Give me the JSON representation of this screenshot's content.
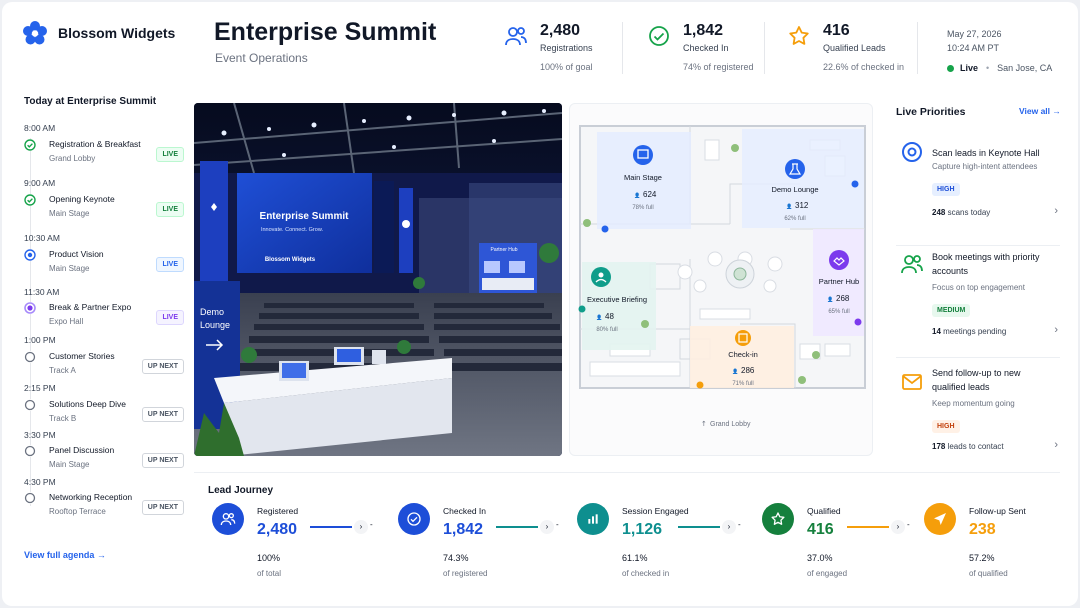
{
  "brand": {
    "name": "Blossom Widgets"
  },
  "header": {
    "title": "Enterprise Summit",
    "subtitle": "Event Operations"
  },
  "kpis": [
    {
      "value": "2,480",
      "label": "Registrations",
      "sub": "100% of goal",
      "icon": "users-icon",
      "color": "#2563eb"
    },
    {
      "value": "1,842",
      "label": "Checked In",
      "sub": "74% of registered",
      "icon": "check-circle-icon",
      "color": "#16a34a"
    },
    {
      "value": "416",
      "label": "Qualified Leads",
      "sub": "22.6% of checked in",
      "icon": "star-icon",
      "color": "#f59e0b"
    }
  ],
  "meta": {
    "date": "May 27, 2026",
    "time": "10:24 AM PT",
    "status": "Live",
    "location": "San Jose, CA"
  },
  "agenda": {
    "title": "Today at Enterprise Summit",
    "link": "View full agenda →",
    "items": [
      {
        "time": "8:00 AM",
        "name": "Registration & Breakfast",
        "loc": "Grand Lobby",
        "badge": "LIVE"
      },
      {
        "time": "9:00 AM",
        "name": "Opening Keynote",
        "loc": "Main Stage",
        "badge": "LIVE"
      },
      {
        "time": "10:30 AM",
        "name": "Product Vision",
        "loc": "Main Stage",
        "badge": "LIVE"
      },
      {
        "time": "11:30 AM",
        "name": "Break & Partner Expo",
        "loc": "Expo Hall",
        "badge": "LIVE"
      },
      {
        "time": "1:00 PM",
        "name": "Customer Stories",
        "loc": "Track A",
        "badge": "UP NEXT"
      },
      {
        "time": "2:15 PM",
        "name": "Solutions Deep Dive",
        "loc": "Track B",
        "badge": "UP NEXT"
      },
      {
        "time": "3:30 PM",
        "name": "Panel Discussion",
        "loc": "Main Stage",
        "badge": "UP NEXT"
      },
      {
        "time": "4:30 PM",
        "name": "Networking Reception",
        "loc": "Rooftop Terrace",
        "badge": "UP NEXT"
      }
    ]
  },
  "photo": {
    "screen_title": "Enterprise Summit",
    "screen_tagline": "Innovate. Connect. Grow.",
    "screen_brand": "Blossom Widgets",
    "sign_demo": "Demo",
    "sign_lounge": "Lounge",
    "sign_partner": "Partner Hub"
  },
  "map": {
    "rooms": [
      {
        "name": "Main Stage",
        "count": "624",
        "pct": "78% full",
        "color": "#2563eb"
      },
      {
        "name": "Demo Lounge",
        "count": "312",
        "pct": "62% full",
        "color": "#2563eb"
      },
      {
        "name": "Partner Hub",
        "count": "268",
        "pct": "65% full",
        "color": "#7c3aed"
      },
      {
        "name": "Executive Briefing",
        "count": "48",
        "pct": "80% full",
        "color": "#0f9d8a"
      },
      {
        "name": "Check-in",
        "count": "286",
        "pct": "71% full",
        "color": "#f59e0b"
      }
    ],
    "entrance": "Grand Lobby"
  },
  "priorities": {
    "title": "Live Priorities",
    "view_all": "View all →",
    "items": [
      {
        "name": "Scan leads in Keynote Hall",
        "desc": "Capture high-intent attendees",
        "badge": "HIGH",
        "count": "248",
        "foot": " scans today"
      },
      {
        "name": "Book meetings with priority accounts",
        "desc": "Focus on top engagement",
        "badge": "MEDIUM",
        "count": "14",
        "foot": " meetings pending"
      },
      {
        "name": "Send follow-up to new qualified leads",
        "desc": "Keep momentum going",
        "badge": "HIGH",
        "count": "178",
        "foot": " leads to contact"
      }
    ]
  },
  "journey": {
    "title": "Lead Journey",
    "stages": [
      {
        "label": "Registered",
        "value": "2,480",
        "pct": "100%",
        "of": "of total",
        "color": "#1d4ed8"
      },
      {
        "label": "Checked In",
        "value": "1,842",
        "pct": "74.3%",
        "of": "of registered",
        "color": "#1d4ed8"
      },
      {
        "label": "Session Engaged",
        "value": "1,126",
        "pct": "61.1%",
        "of": "of checked in",
        "color": "#0e8f8f"
      },
      {
        "label": "Qualified",
        "value": "416",
        "pct": "37.0%",
        "of": "of engaged",
        "color": "#15803d"
      },
      {
        "label": "Follow-up Sent",
        "value": "238",
        "pct": "57.2%",
        "of": "of qualified",
        "color": "#f59e0b"
      }
    ]
  }
}
